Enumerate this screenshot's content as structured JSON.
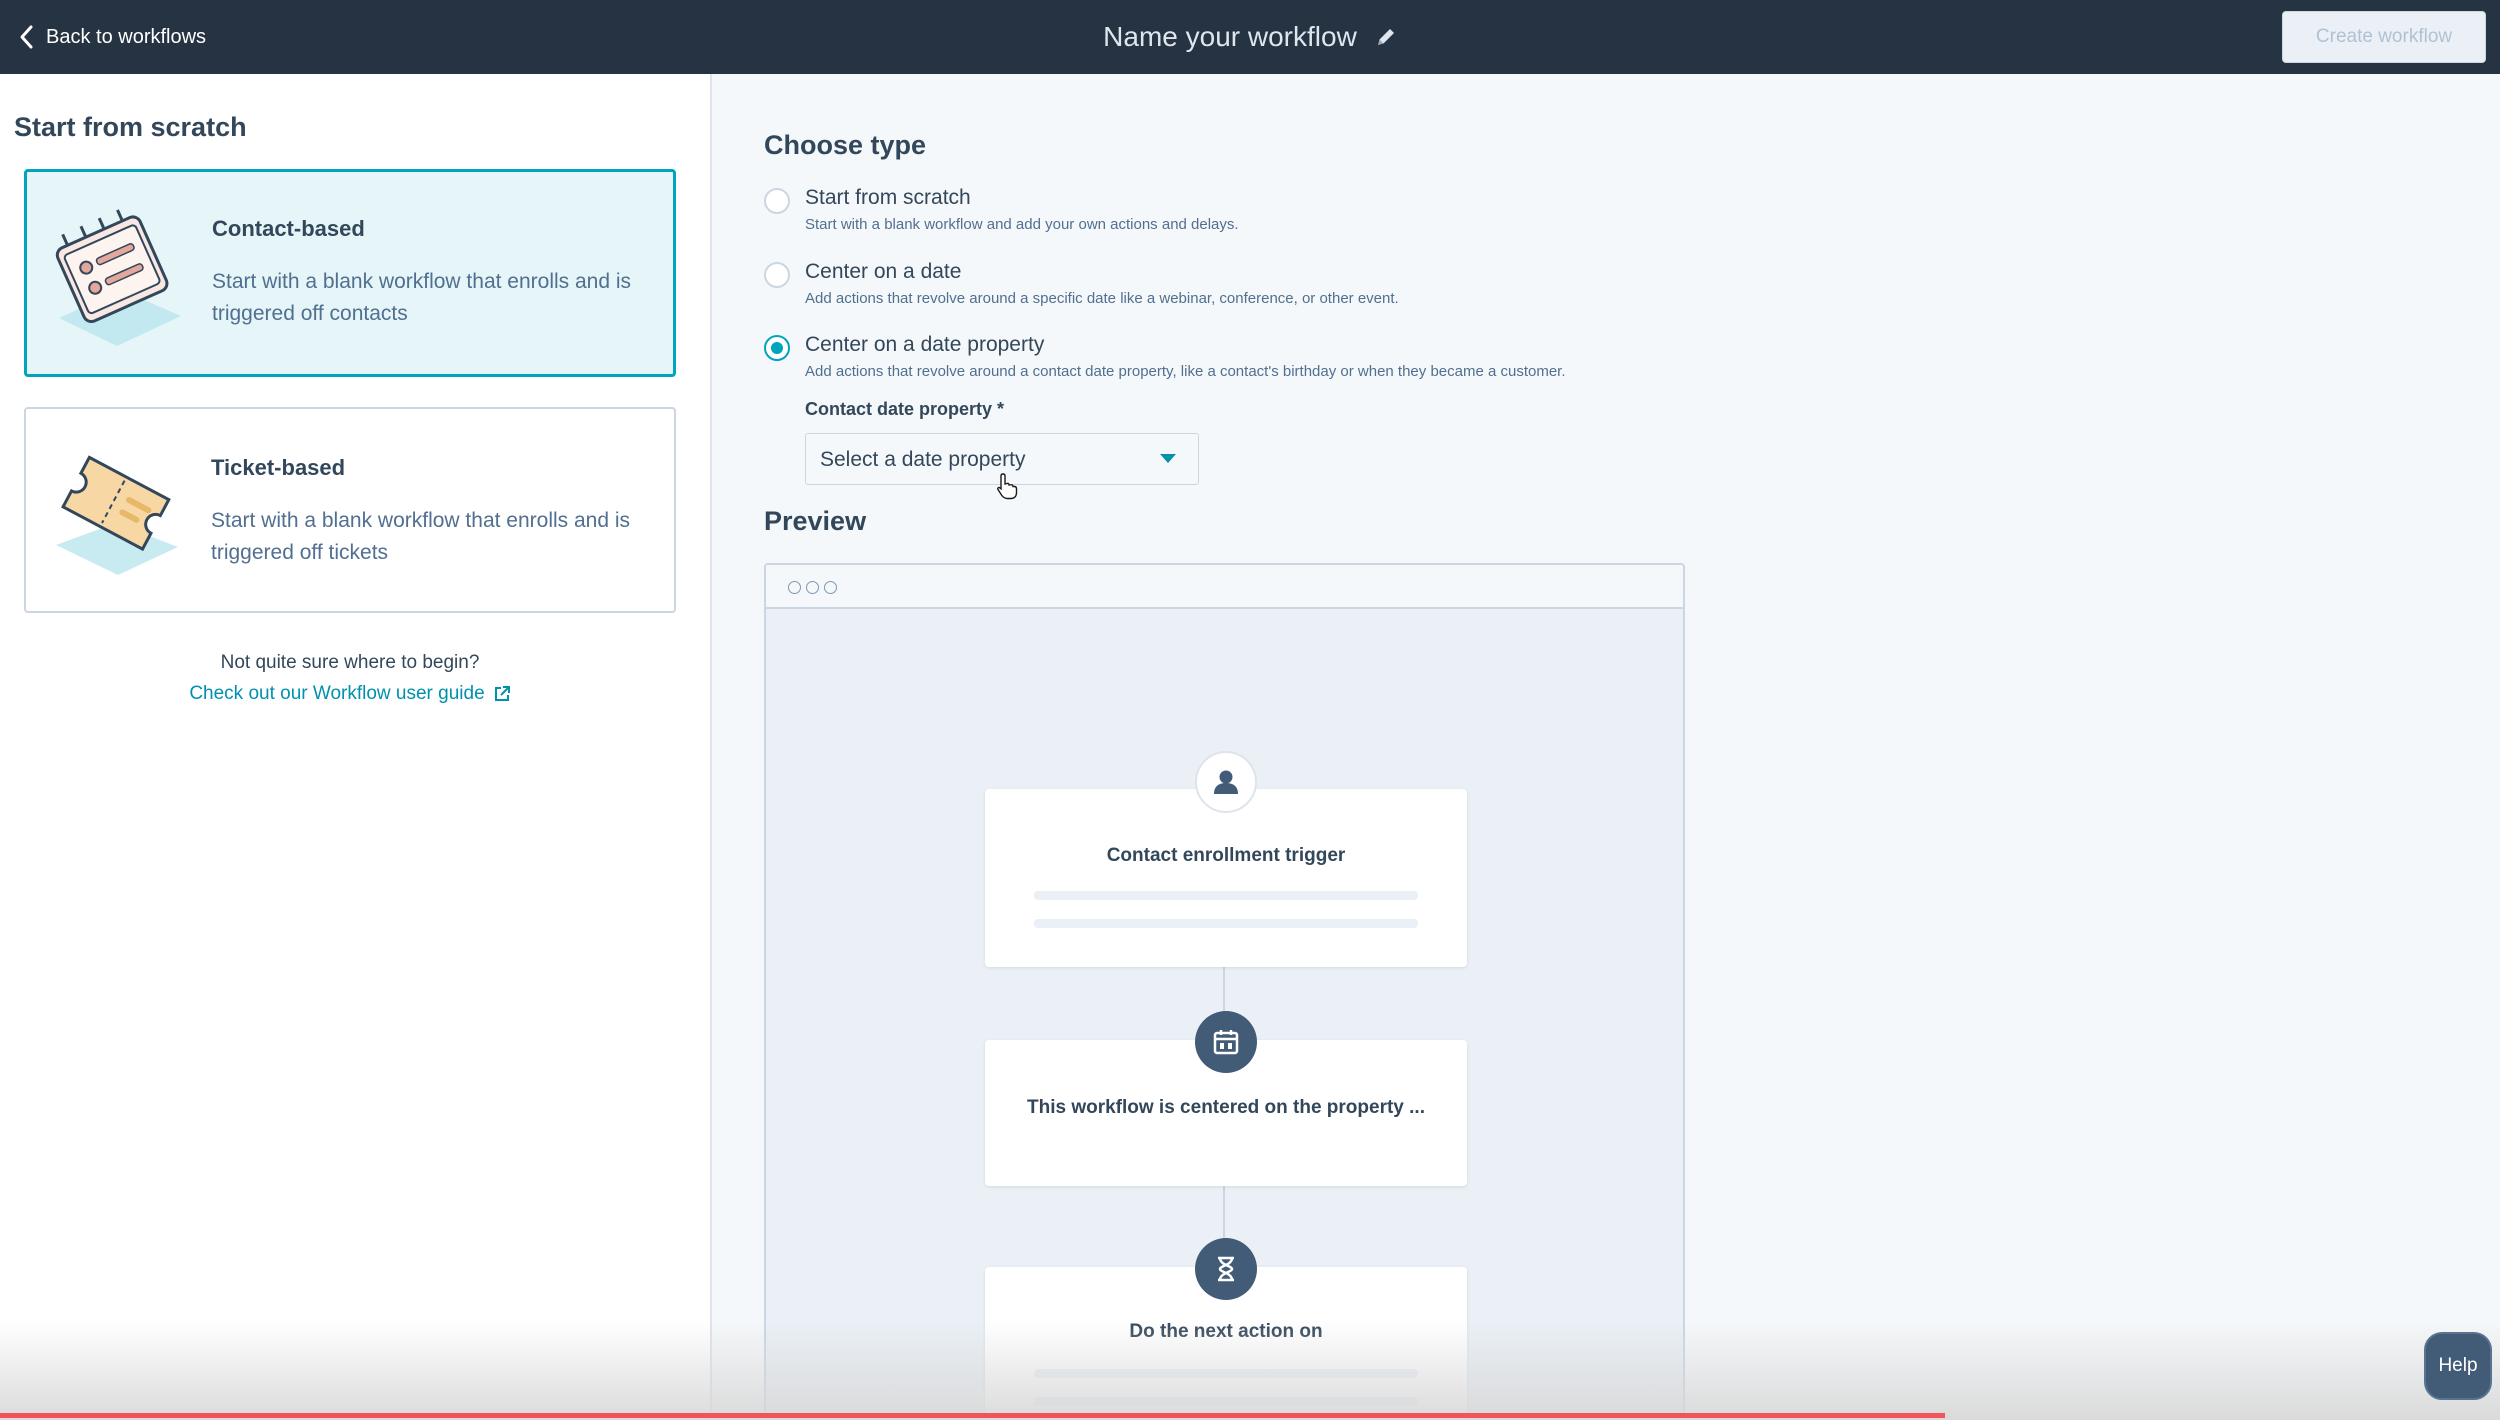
{
  "header": {
    "back_label": "Back to workflows",
    "workflow_name": "Name your workflow",
    "create_label": "Create workflow"
  },
  "sidebar": {
    "heading": "Start from scratch",
    "cards": [
      {
        "title": "Contact-based",
        "description": "Start with a blank workflow that enrolls and is triggered off contacts",
        "selected": true
      },
      {
        "title": "Ticket-based",
        "description": "Start with a blank workflow that enrolls and is triggered off tickets",
        "selected": false
      }
    ],
    "help_text": "Not quite sure where to begin?",
    "guide_link": "Check out our Workflow user guide"
  },
  "main": {
    "choose_heading": "Choose type",
    "options": [
      {
        "label": "Start from scratch",
        "sub": "Start with a blank workflow and add your own actions and delays.",
        "checked": false
      },
      {
        "label": "Center on a date",
        "sub": "Add actions that revolve around a specific date like a webinar, conference, or other event.",
        "checked": false
      },
      {
        "label": "Center on a date property",
        "sub": "Add actions that revolve around a contact date property, like a contact's birthday or when they became a customer.",
        "checked": true
      }
    ],
    "field_label": "Contact date property *",
    "select_placeholder": "Select a date property",
    "preview_heading": "Preview",
    "preview_steps": [
      {
        "text": "Contact enrollment trigger",
        "icon": "person-icon"
      },
      {
        "text": "This workflow is centered on the property ...",
        "icon": "calendar-icon"
      },
      {
        "text": "Do the next action on",
        "icon": "hourglass-icon"
      }
    ]
  },
  "help_button": "Help",
  "colors": {
    "topbar": "#253342",
    "accent": "#00a4bd",
    "link": "#0091ae",
    "text": "#33475b"
  }
}
